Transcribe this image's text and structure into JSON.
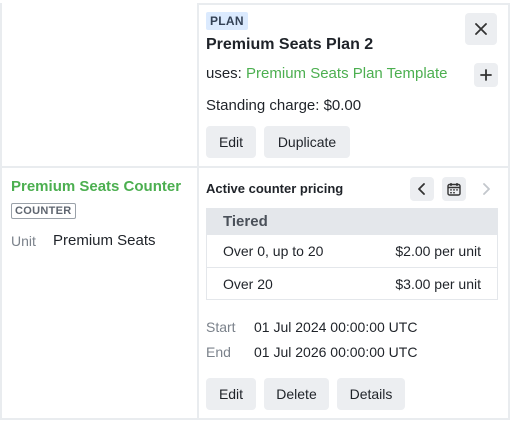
{
  "plan": {
    "badge": "PLAN",
    "title": "Premium Seats Plan 2",
    "uses_label": "uses:",
    "uses_link": "Premium Seats Plan Template",
    "standing_charge": "Standing charge: $0.00",
    "edit_label": "Edit",
    "duplicate_label": "Duplicate"
  },
  "counter": {
    "title": "Premium Seats Counter",
    "badge": "COUNTER",
    "unit_label": "Unit",
    "unit_value": "Premium Seats"
  },
  "pricing": {
    "title": "Active counter pricing",
    "table_header": "Tiered",
    "rows": [
      {
        "range": "Over 0, up to 20",
        "price": "$2.00 per unit"
      },
      {
        "range": "Over 20",
        "price": "$3.00 per unit"
      }
    ],
    "start_label": "Start",
    "start_value": "01 Jul 2024 00:00:00 UTC",
    "end_label": "End",
    "end_value": "01 Jul 2026 00:00:00 UTC",
    "edit_label": "Edit",
    "delete_label": "Delete",
    "details_label": "Details"
  },
  "icons": {
    "close": "close-icon",
    "plus": "plus-icon",
    "prev": "chevron-left-icon",
    "calendar": "calendar-icon",
    "next": "chevron-right-icon"
  },
  "colors": {
    "accent_green": "#4caf50",
    "badge_bg": "#dbeafe",
    "button_bg": "#eceef1"
  }
}
